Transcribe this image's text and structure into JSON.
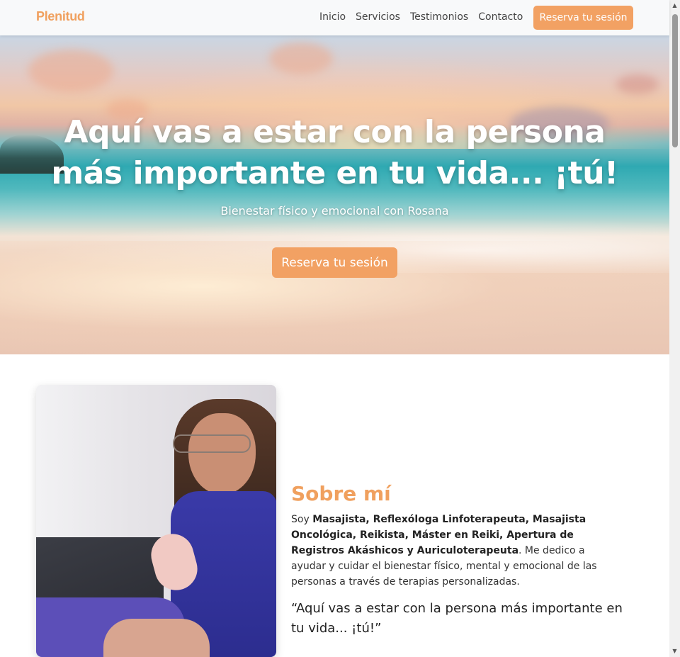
{
  "navbar": {
    "brand": "Plenitud",
    "links": [
      "Inicio",
      "Servicios",
      "Testimonios",
      "Contacto"
    ],
    "cta_label": "Reserva tu sesión",
    "accent_color": "#f2a163"
  },
  "hero": {
    "title_line1": "Aquí vas a estar con la persona",
    "title_line2": "más importante en tu vida... ¡tú!",
    "subtitle": "Bienestar físico y emocional con Rosana",
    "cta_label": "Reserva tu sesión"
  },
  "about": {
    "title": "Sobre mí",
    "intro_prefix": "Soy ",
    "credentials": "Masajista, Reflexóloga Linfoterapeuta, Masajista Oncológica, Reikista, Máster en Reiki, Apertura de Registros Akáshicos y Auriculoterapeuta",
    "intro_suffix": ". Me dedico a ayudar y cuidar el bienestar físico, mental y emocional de las personas a través de terapias personalizadas.",
    "quote": "“Aquí vas a estar con la persona más importante en tu vida... ¡tú!”"
  },
  "scrollbar": {
    "up_icon": "▲",
    "down_icon": "▼"
  }
}
